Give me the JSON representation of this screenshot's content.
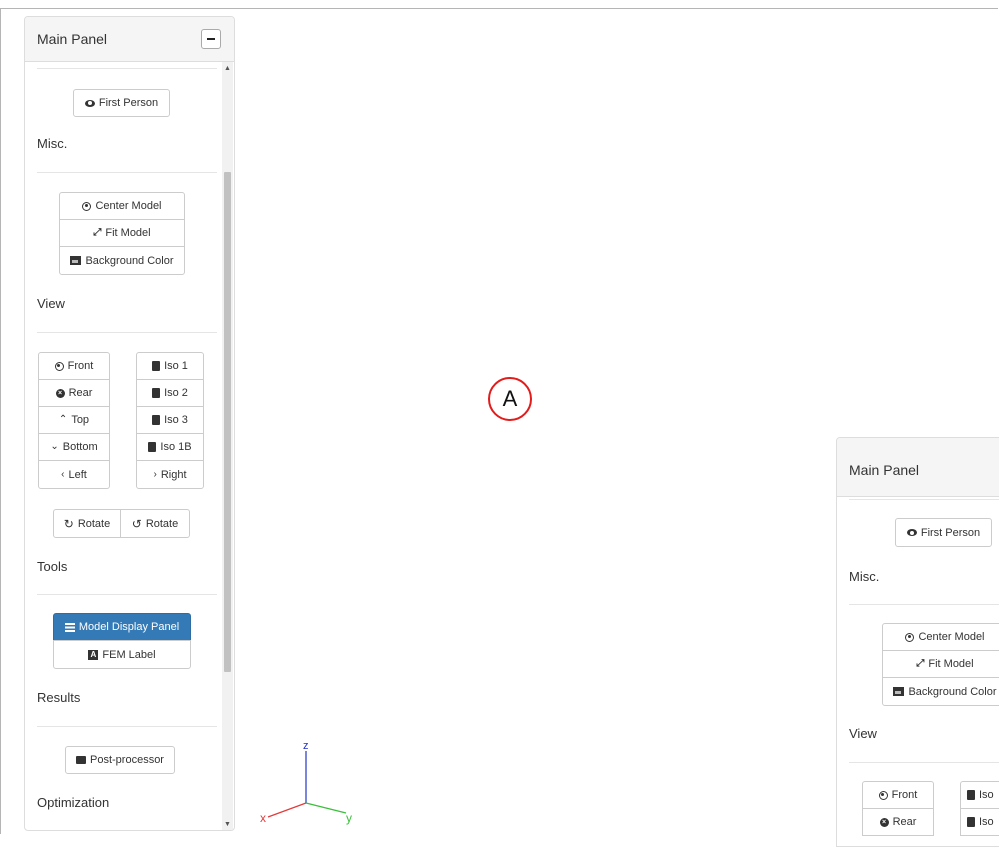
{
  "main_panel": {
    "title": "Main Panel",
    "first_person": "First Person",
    "sections": {
      "misc": "Misc.",
      "view": "View",
      "tools": "Tools",
      "results": "Results",
      "optimization": "Optimization"
    },
    "misc_buttons": [
      "Center Model",
      "Fit Model",
      "Background Color"
    ],
    "view_left": [
      "Front",
      "Rear",
      "Top",
      "Bottom",
      "Left"
    ],
    "view_right": [
      "Iso 1",
      "Iso 2",
      "Iso 3",
      "Iso 1B",
      "Right"
    ],
    "rotate_cw": "Rotate",
    "rotate_ccw": "Rotate",
    "tools_buttons": [
      "Model Display Panel",
      "FEM Label"
    ],
    "results_buttons": [
      "Post-processor"
    ]
  },
  "second_panel": {
    "title": "Main Panel",
    "first_person": "First Person",
    "sections": {
      "misc": "Misc.",
      "view": "View"
    },
    "misc_buttons": [
      "Center Model",
      "Fit Model",
      "Background Color"
    ],
    "view_left": [
      "Front",
      "Rear"
    ],
    "view_right": [
      "Iso",
      "Iso"
    ]
  },
  "axes": {
    "z": "z",
    "x": "x",
    "y": "y"
  },
  "marker": {
    "label": "A"
  },
  "colors": {
    "accent": "#337ab7",
    "marker_ring": "#e21b1b",
    "axis_x": "#e23b3b",
    "axis_y": "#3bbf3b",
    "axis_z": "#2233cc"
  }
}
